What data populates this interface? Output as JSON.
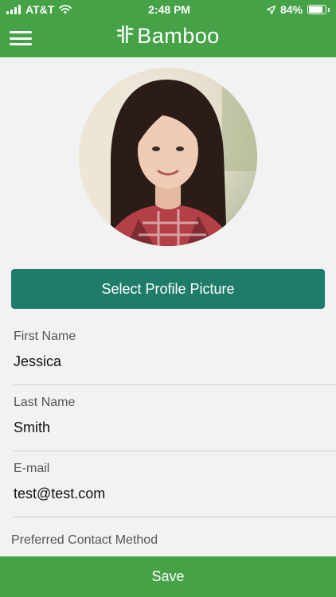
{
  "status_bar": {
    "carrier": "AT&T",
    "time": "2:48 PM",
    "battery": "84%",
    "battery_level": 0.84,
    "icons": [
      "signal-bars-icon",
      "wifi-icon",
      "location-arrow-icon",
      "battery-icon"
    ]
  },
  "header": {
    "brand": "Bamboo",
    "menu_icon": "hamburger-menu-icon",
    "logo_icon": "bamboo-leaf-icon",
    "color": "#45a247"
  },
  "profile": {
    "select_picture_label": "Select Profile Picture",
    "button_color": "#1f7c6a"
  },
  "form": {
    "first_name_label": "First Name",
    "first_name_value": "Jessica",
    "last_name_label": "Last Name",
    "last_name_value": "Smith",
    "email_label": "E-mail",
    "email_value": "test@test.com",
    "preferred_contact_label": "Preferred Contact Method"
  },
  "footer": {
    "save_label": "Save"
  }
}
